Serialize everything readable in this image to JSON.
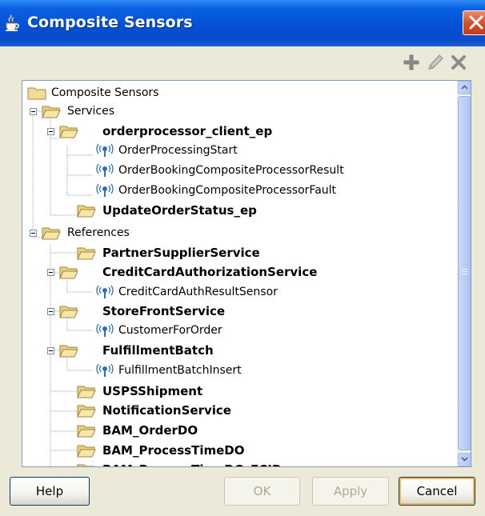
{
  "window": {
    "title": "Composite Sensors"
  },
  "toolbar": {
    "add_icon": "plus-icon",
    "edit_icon": "pencil-icon",
    "delete_icon": "x-icon"
  },
  "tree": {
    "root": "Composite Sensors",
    "services_group": "Services",
    "orderprocessor_client_ep": "orderprocessor_client_ep",
    "sensor_order_processing_start": "OrderProcessingStart",
    "sensor_order_booking_result": "OrderBookingCompositeProcessorResult",
    "sensor_order_booking_fault": "OrderBookingCompositeProcessorFault",
    "update_order_status_ep": "UpdateOrderStatus_ep",
    "references_group": "References",
    "partner_supplier_service": "PartnerSupplierService",
    "credit_card_authorization_service": "CreditCardAuthorizationService",
    "sensor_credit_card_auth_result": "CreditCardAuthResultSensor",
    "store_front_service": "StoreFrontService",
    "sensor_customer_for_order": "CustomerForOrder",
    "fulfillment_batch": "FulfillmentBatch",
    "sensor_fulfillment_batch_insert": "FulfillmentBatchInsert",
    "usps_shipment": "USPSShipment",
    "notification_service": "NotificationService",
    "bam_order_do": "BAM_OrderDO",
    "bam_process_time_do": "BAM_ProcessTimeDO",
    "bam_process_time_do_ecid": "BAM_ProcessTimeDO_ECID"
  },
  "buttons": {
    "help": "Help",
    "ok": "OK",
    "apply": "Apply",
    "cancel": "Cancel"
  },
  "colors": {
    "titlebar": "#0450d5",
    "close_button": "#d8502b",
    "dialog_background": "#ece9d8",
    "folder": "#f1d98c",
    "default_button_focus": "#f8b34c"
  }
}
